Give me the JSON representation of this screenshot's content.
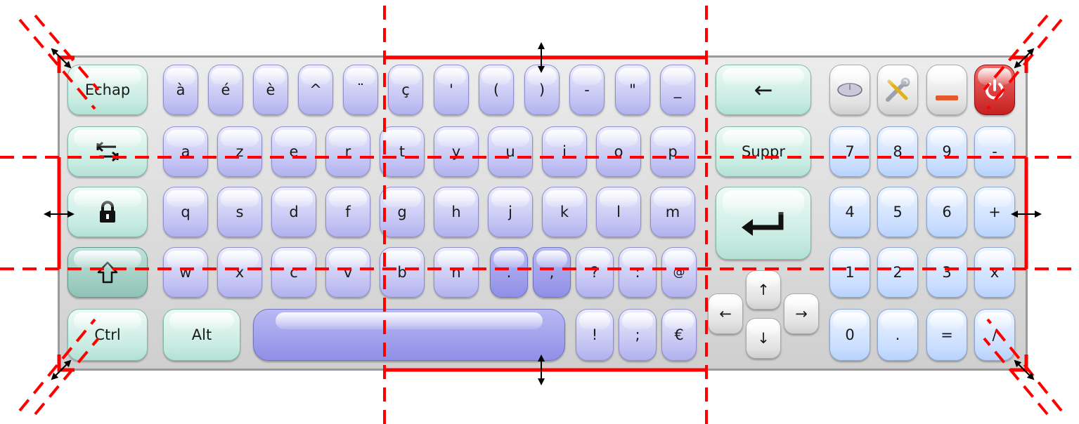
{
  "keyboard": {
    "row1": [
      "Echap",
      "à",
      "é",
      "è",
      "^",
      "¨",
      "ç",
      "'",
      "(",
      ")",
      "-",
      "\"",
      "_"
    ],
    "row2": [
      "a",
      "z",
      "e",
      "r",
      "t",
      "y",
      "u",
      "i",
      "o",
      "p"
    ],
    "row3": [
      "q",
      "s",
      "d",
      "f",
      "g",
      "h",
      "j",
      "k",
      "l",
      "m"
    ],
    "row4": [
      "w",
      "x",
      "c",
      "v",
      "b",
      "n",
      ".",
      ",",
      "?",
      ":",
      "@"
    ],
    "row5": [
      "Ctrl",
      "Alt",
      "!",
      ";",
      "€"
    ],
    "backspace": "←",
    "delete": "Suppr",
    "tab": "⭾",
    "lock": "🔒",
    "shift": "⇧",
    "enter": "↵",
    "arrows": {
      "up": "↑",
      "down": "↓",
      "left": "←",
      "right": "→"
    },
    "numpad": [
      "7",
      "8",
      "9",
      "-",
      "4",
      "5",
      "6",
      "+",
      "1",
      "2",
      "3",
      "x",
      "0",
      ".",
      "=",
      "/"
    ],
    "tools": {
      "mouse": "mouse-icon",
      "settings": "tools-icon",
      "minimize": "minimize-icon",
      "power": "power-icon"
    }
  },
  "colors": {
    "letter_key": "#c4c4f4",
    "dark_key": "#8f8fe7",
    "function_key": "#c6ebe1",
    "number_key": "#cadeff",
    "power_key": "#c61f1f",
    "guide": "#ff0000"
  }
}
